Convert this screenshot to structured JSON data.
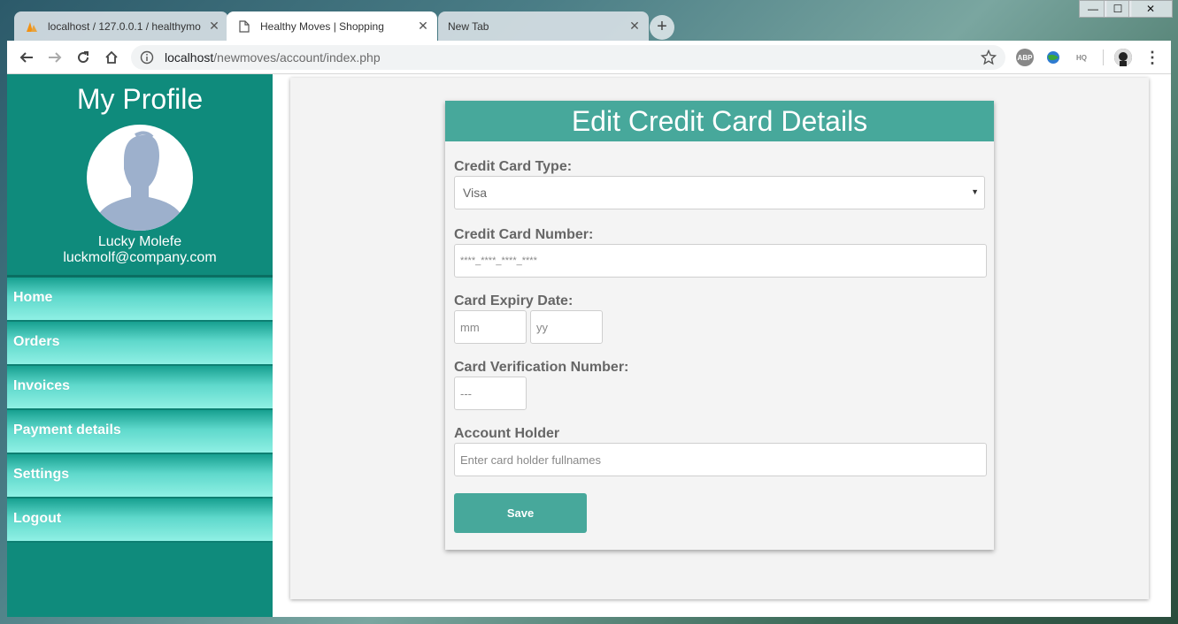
{
  "browser": {
    "tabs": [
      {
        "title": "localhost / 127.0.0.1 / healthymo",
        "icon": "phpmyadmin-icon",
        "active": false
      },
      {
        "title": "Healthy Moves | Shopping",
        "icon": "page-icon",
        "active": true
      },
      {
        "title": "New Tab",
        "icon": "",
        "active": false
      }
    ],
    "new_tab_symbol": "+",
    "close_symbol": "✕",
    "url_host": "localhost",
    "url_path": "/newmoves/account/index.php",
    "window_controls": {
      "minimize": "—",
      "maximize": "☐",
      "close": "✕"
    },
    "extensions": [
      {
        "name": "abp-icon",
        "label": "ABP"
      },
      {
        "name": "globe-extension-icon",
        "label": ""
      },
      {
        "name": "cloudhq-icon",
        "label": "HQ"
      }
    ]
  },
  "sidebar": {
    "title": "My Profile",
    "user_name": "Lucky Molefe",
    "user_email": "luckmolf@company.com",
    "menu": [
      {
        "label": "Home"
      },
      {
        "label": "Orders"
      },
      {
        "label": "Invoices"
      },
      {
        "label": "Payment details"
      },
      {
        "label": "Settings"
      },
      {
        "label": "Logout"
      }
    ]
  },
  "form": {
    "title": "Edit Credit Card Details",
    "card_type_label": "Credit Card Type:",
    "card_type_value": "Visa",
    "card_number_label": "Credit Card Number:",
    "card_number_placeholder": "****_****_****_****",
    "expiry_label": "Card Expiry Date:",
    "expiry_month_placeholder": "mm",
    "expiry_year_placeholder": "yy",
    "cvv_label": "Card Verification Number:",
    "cvv_placeholder": "---",
    "holder_label": "Account Holder",
    "holder_placeholder": "Enter card holder fullnames",
    "save_label": "Save"
  },
  "colors": {
    "sidebar_bg": "#0f8b7c",
    "accent": "#47a89b"
  }
}
